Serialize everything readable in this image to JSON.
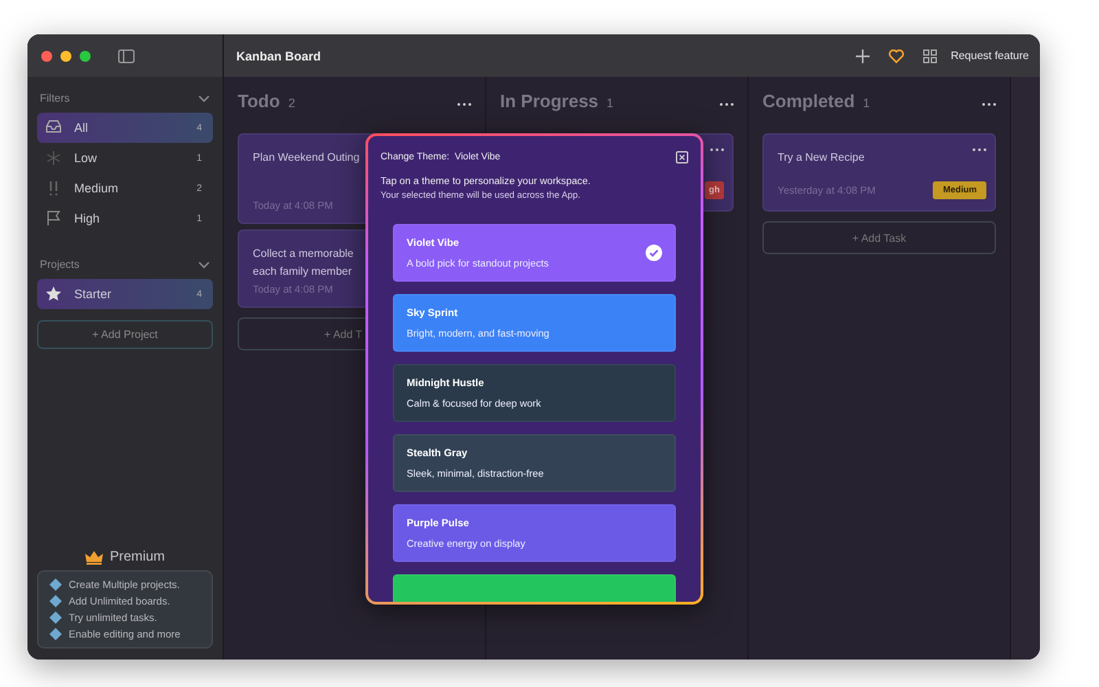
{
  "window": {
    "title": "Kanban Board"
  },
  "toolbar": {
    "request_feature": "Request feature"
  },
  "sidebar": {
    "filters_heading": "Filters",
    "filters": [
      {
        "label": "All",
        "count": "4",
        "selected": true
      },
      {
        "label": "Low",
        "count": "1",
        "selected": false
      },
      {
        "label": "Medium",
        "count": "2",
        "selected": false
      },
      {
        "label": "High",
        "count": "1",
        "selected": false
      }
    ],
    "projects_heading": "Projects",
    "projects": [
      {
        "label": "Starter",
        "count": "4",
        "selected": true
      }
    ],
    "add_project": "+ Add Project",
    "premium": {
      "title": "Premium",
      "features": [
        "Create Multiple projects.",
        "Add Unlimited boards.",
        "Try unlimited tasks.",
        "Enable editing and more"
      ]
    }
  },
  "columns": [
    {
      "title": "Todo",
      "count": "2",
      "cards": [
        {
          "title_lines": [
            "Plan Weekend Outing"
          ],
          "time": "Today at 4:08 PM"
        },
        {
          "title_lines": [
            "Collect a memorable",
            "each family member"
          ],
          "time": "Today at 4:08 PM"
        }
      ],
      "add_task": "+ Add T"
    },
    {
      "title": "In Progress",
      "count": "1",
      "cards": [
        {
          "badge": {
            "text": "gh",
            "kind": "high"
          }
        }
      ]
    },
    {
      "title": "Completed",
      "count": "1",
      "cards": [
        {
          "title_lines": [
            "Try a New Recipe"
          ],
          "time": "Yesterday at 4:08 PM",
          "badge": {
            "text": "Medium",
            "kind": "medium"
          }
        }
      ],
      "add_task": "+ Add Task"
    }
  ],
  "theme_dialog": {
    "title": "Change Theme:  Violet Vibe",
    "intro": "Tap on a theme to personalize your workspace.",
    "note": "Your selected theme will be used across the App.",
    "themes": [
      {
        "name": "Violet Vibe",
        "description": "A bold pick for standout projects",
        "color": "#8b5cf6",
        "selected": true
      },
      {
        "name": "Sky Sprint",
        "description": "Bright, modern, and fast-moving",
        "color": "#3b82f6",
        "selected": false
      },
      {
        "name": "Midnight Hustle",
        "description": "Calm & focused for deep work",
        "color": "#2a3a4a",
        "selected": false
      },
      {
        "name": "Stealth Gray",
        "description": "Sleek, minimal, distraction-free",
        "color": "#334355",
        "selected": false
      },
      {
        "name": "Purple Pulse",
        "description": "Creative energy on display",
        "color": "#6b5ae6",
        "selected": false
      },
      {
        "color": "#22c55e",
        "selected": false
      }
    ]
  }
}
